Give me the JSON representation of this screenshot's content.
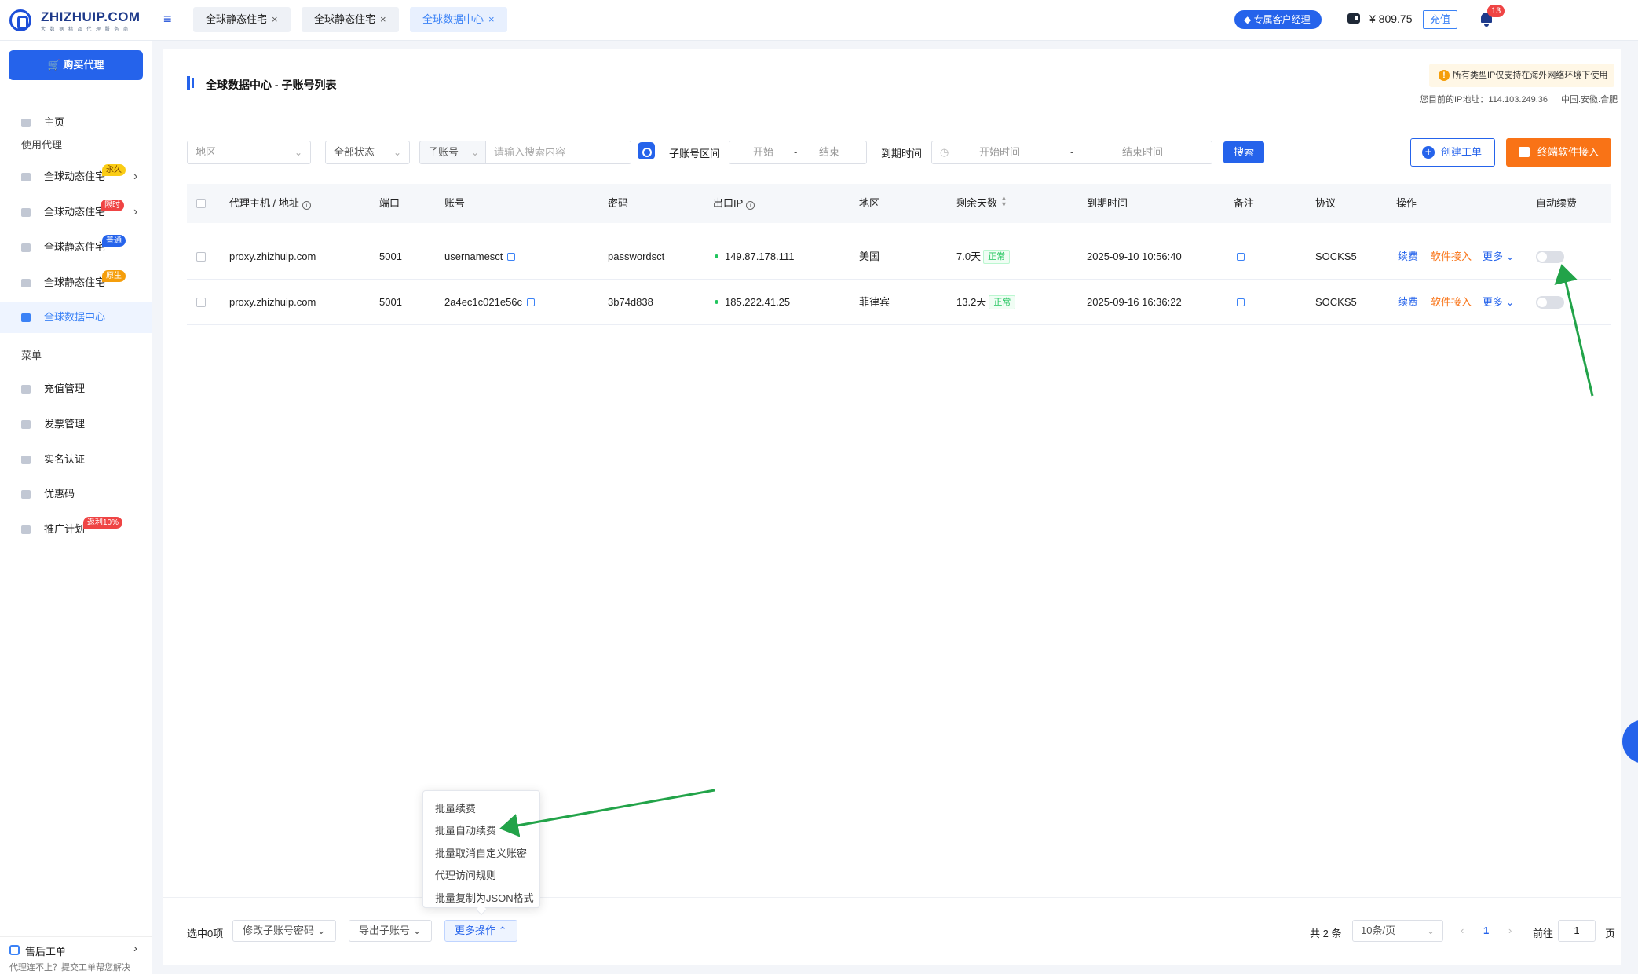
{
  "brand": {
    "name": "ZHIZHUIP.COM",
    "tagline": "大 数 据 精 品 代 理 服 务 商"
  },
  "tabs": [
    {
      "label": "全球静态住宅"
    },
    {
      "label": "全球静态住宅"
    },
    {
      "label": "全球数据中心"
    }
  ],
  "header": {
    "manager_label": "专属客户经理",
    "balance": "¥ 809.75",
    "recharge_label": "充值",
    "notification_count": "13"
  },
  "sidebar": {
    "buy_label": "购买代理",
    "home_label": "主页",
    "group_use": "使用代理",
    "items": [
      {
        "label": "全球动态住宅",
        "badge": "永久"
      },
      {
        "label": "全球动态住宅",
        "badge": "限时"
      },
      {
        "label": "全球静态住宅",
        "badge": "普通"
      },
      {
        "label": "全球静态住宅",
        "badge": "原生"
      },
      {
        "label": "全球数据中心"
      }
    ],
    "group_menu": "菜单",
    "menu_items": [
      {
        "label": "充值管理"
      },
      {
        "label": "发票管理"
      },
      {
        "label": "实名认证"
      },
      {
        "label": "优惠码"
      },
      {
        "label": "推广计划",
        "badge": "返利10%"
      }
    ],
    "support_title": "售后工单",
    "support_sub": "代理连不上？提交工单帮您解决"
  },
  "page": {
    "title": "全球数据中心 - 子账号列表",
    "notice": "所有类型IP仅支持在海外网络环境下使用",
    "ip_line": "您目前的IP地址：114.103.249.36",
    "ip_region": "中国.安徽.合肥"
  },
  "filters": {
    "region_placeholder": "地区",
    "status_value": "全部状态",
    "account_type": "子账号",
    "search_placeholder": "请输入搜索内容",
    "range_label": "子账号区间",
    "range_start": "开始",
    "range_sep": "-",
    "range_end": "结束",
    "expire_label": "到期时间",
    "expire_start": "开始时间",
    "expire_sep": "-",
    "expire_end": "结束时间",
    "search_button": "搜索",
    "create_ticket": "创建工单",
    "terminal_access": "终端软件接入"
  },
  "table": {
    "headers": {
      "host": "代理主机 / 地址",
      "port": "端口",
      "account": "账号",
      "password": "密码",
      "exit_ip": "出口IP",
      "region": "地区",
      "days_left": "剩余天数",
      "expire": "到期时间",
      "note": "备注",
      "protocol": "协议",
      "ops": "操作",
      "auto_renew": "自动续费"
    },
    "rows": [
      {
        "host": "proxy.zhizhuip.com",
        "port": "5001",
        "account": "usernamesct",
        "password": "passwordsct",
        "exit_ip": "149.87.178.111",
        "region": "美国",
        "days_left": "7.0天",
        "status": "正常",
        "expire": "2025-09-10 10:56:40",
        "protocol": "SOCKS5",
        "op_renew": "续费",
        "op_software": "软件接入",
        "op_more": "更多"
      },
      {
        "host": "proxy.zhizhuip.com",
        "port": "5001",
        "account": "2a4ec1c021e56c",
        "password": "3b74d838",
        "exit_ip": "185.222.41.25",
        "region": "菲律宾",
        "days_left": "13.2天",
        "status": "正常",
        "expire": "2025-09-16 16:36:22",
        "protocol": "SOCKS5",
        "op_renew": "续费",
        "op_software": "软件接入",
        "op_more": "更多"
      }
    ]
  },
  "more_menu": {
    "options": [
      "批量续费",
      "批量自动续费",
      "批量取消自定义账密",
      "代理访问规则",
      "批量复制为JSON格式"
    ]
  },
  "bottom": {
    "selected": "选中0项",
    "modify_pwd": "修改子账号密码",
    "export": "导出子账号",
    "more_ops": "更多操作",
    "total": "共 2 条",
    "page_size": "10条/页",
    "current_page": "1",
    "goto_label": "前往",
    "goto_value": "1",
    "page_unit": "页"
  },
  "colors": {
    "primary": "#2563eb",
    "orange": "#f97316",
    "annotation_arrow": "#22a349"
  }
}
